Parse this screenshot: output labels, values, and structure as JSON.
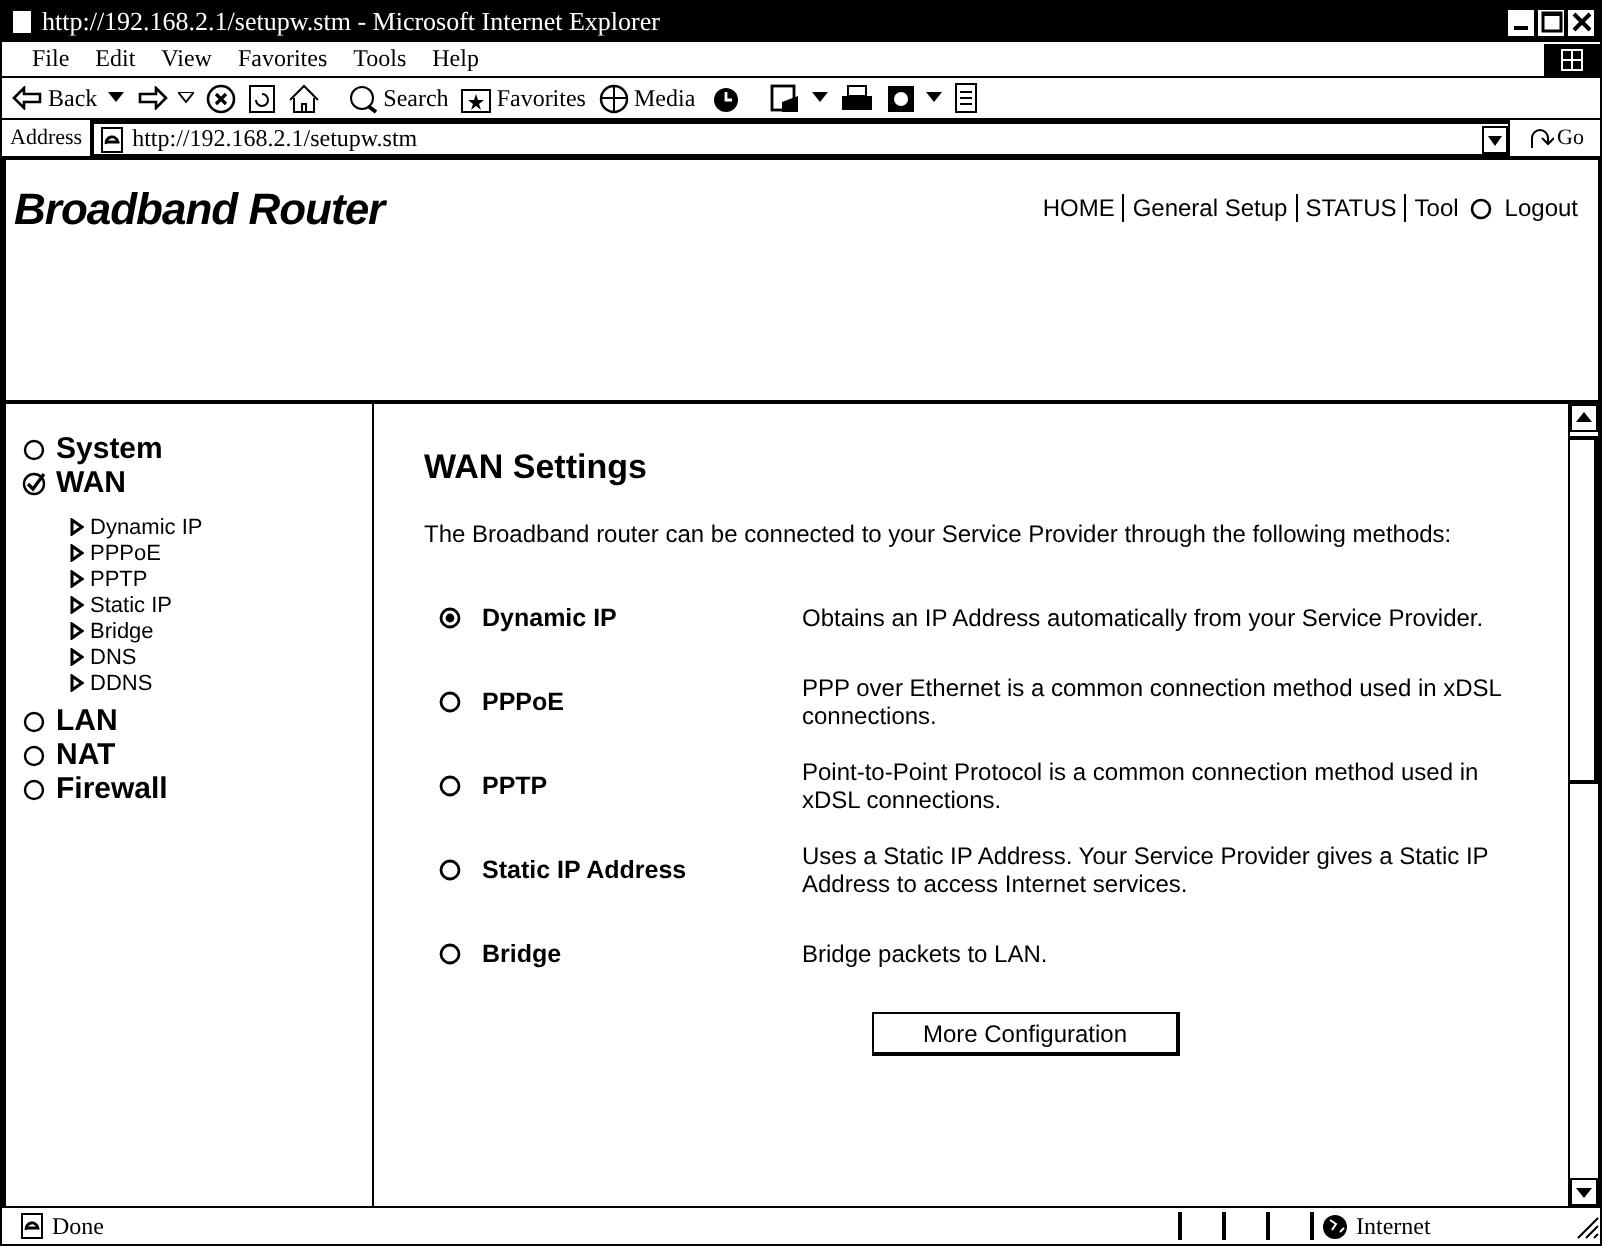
{
  "window": {
    "title": "http://192.168.2.1/setupw.stm - Microsoft Internet Explorer"
  },
  "menu": [
    {
      "label": "File"
    },
    {
      "label": "Edit"
    },
    {
      "label": "View"
    },
    {
      "label": "Favorites"
    },
    {
      "label": "Tools"
    },
    {
      "label": "Help"
    }
  ],
  "toolbar": [
    {
      "kind": "back",
      "label": "Back"
    },
    {
      "kind": "forward"
    },
    {
      "kind": "stop"
    },
    {
      "kind": "refresh"
    },
    {
      "kind": "home"
    },
    {
      "kind": "search",
      "label": "Search"
    },
    {
      "kind": "favorites",
      "label": "Favorites"
    },
    {
      "kind": "media",
      "label": "Media"
    },
    {
      "kind": "history"
    },
    {
      "kind": "mail"
    },
    {
      "kind": "print"
    },
    {
      "kind": "edit"
    },
    {
      "kind": "discuss"
    }
  ],
  "address": {
    "label": "Address",
    "value": "http://192.168.2.1/setupw.stm",
    "go": "Go"
  },
  "page": {
    "logo": "Broadband Router",
    "nav": [
      {
        "label": "HOME",
        "kind": "link"
      },
      {
        "label": "General Setup",
        "kind": "link"
      },
      {
        "label": "STATUS",
        "kind": "link"
      },
      {
        "label": "Tool",
        "kind": "link"
      },
      {
        "label": "Logout",
        "kind": "logout"
      }
    ],
    "sidebar": [
      {
        "label": "System",
        "selected": false
      },
      {
        "label": "WAN",
        "selected": true,
        "children": [
          {
            "label": "Dynamic IP"
          },
          {
            "label": "PPPoE"
          },
          {
            "label": "PPTP"
          },
          {
            "label": "Static IP"
          },
          {
            "label": "Bridge"
          },
          {
            "label": "DNS"
          },
          {
            "label": "DDNS"
          }
        ]
      },
      {
        "label": "LAN",
        "selected": false
      },
      {
        "label": "NAT",
        "selected": false
      },
      {
        "label": "Firewall",
        "selected": false
      }
    ],
    "heading": "WAN Settings",
    "intro": "The Broadband router can be connected to your Service Provider through the following methods:",
    "options": [
      {
        "label": "Dynamic IP",
        "selected": true,
        "description": "Obtains an IP Address automatically from your Service Provider."
      },
      {
        "label": "PPPoE",
        "selected": false,
        "description": "PPP over Ethernet is a common connection method used in xDSL connections."
      },
      {
        "label": "PPTP",
        "selected": false,
        "description": "Point-to-Point Protocol is a common connection method used in xDSL connections."
      },
      {
        "label": "Static IP Address",
        "selected": false,
        "description": "Uses a Static IP Address. Your Service Provider gives a Static IP Address to access Internet services."
      },
      {
        "label": "Bridge",
        "selected": false,
        "description": "Bridge packets to LAN."
      }
    ],
    "button": "More Configuration"
  },
  "status_bar": {
    "text": "Done",
    "zone": "Internet"
  }
}
